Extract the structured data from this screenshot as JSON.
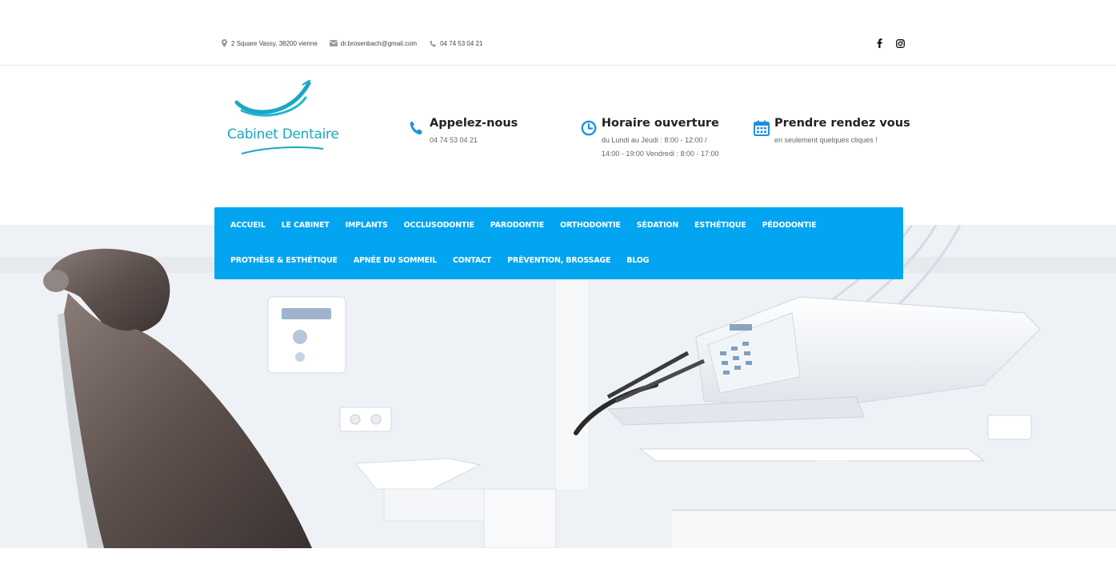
{
  "topbar": {
    "address": "2 Square Vassy, 38200 vienne",
    "email": "dr.brosenbach@gmail.com",
    "phone": "04 74 53 04 21",
    "social": [
      "facebook-icon",
      "instagram-icon"
    ]
  },
  "logo": {
    "text": "Cabinet Dentaire"
  },
  "header": {
    "call": {
      "title": "Appelez-nous",
      "sub": "04 74 53 04 21"
    },
    "hours": {
      "title": "Horaire ouverture",
      "sub": "du Lundi au Jeudi : 8:00 - 12:00 / 14:00 - 19:00 Vendredi : 8:00 - 17:00"
    },
    "appointment": {
      "title": "Prendre rendez vous",
      "sub": "en seulement quelques cliques !"
    }
  },
  "nav": {
    "row1": [
      "ACCUEIL",
      "LE CABINET",
      "IMPLANTS",
      "OCCLUSODONTIE",
      "PARODONTIE",
      "ORTHODONTIE",
      "SÉDATION",
      "ESTHÉTIQUE",
      "PÉDODONTIE"
    ],
    "row2": [
      "PROTHÈSE & ESTHÉTIQUE",
      "APNÉE DU SOMMEIL",
      "CONTACT",
      "PRÉVENTION, BROSSAGE",
      "BLOG"
    ]
  },
  "colors": {
    "accent": "#03a5f0",
    "brand": "#1aa7c5",
    "icon": "#1e90e0"
  }
}
